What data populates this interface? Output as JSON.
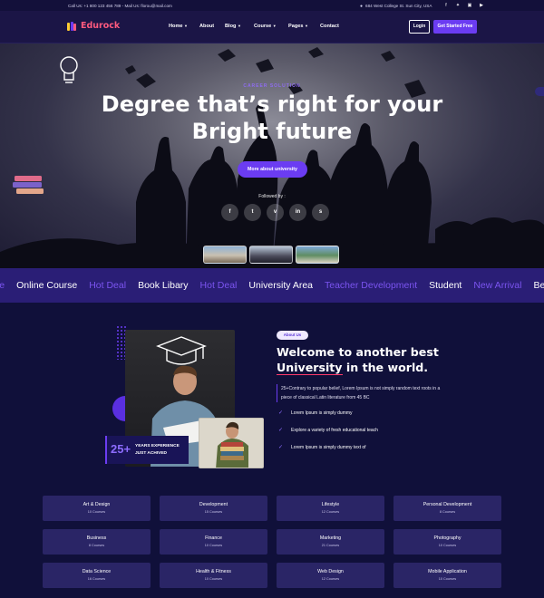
{
  "topbar": {
    "contact": "Call Us: +1 800 123 456 789 - Mail Us: florou@mail.com",
    "address": "684 West College St. Sun City, USA",
    "social_icons": [
      "facebook-icon",
      "twitter-icon",
      "instagram-icon",
      "youtube-icon"
    ]
  },
  "nav": {
    "logo": "Edurock",
    "items": [
      {
        "label": "Home",
        "dropdown": true
      },
      {
        "label": "About",
        "dropdown": false
      },
      {
        "label": "Blog",
        "dropdown": true
      },
      {
        "label": "Course",
        "dropdown": true
      },
      {
        "label": "Pages",
        "dropdown": true
      },
      {
        "label": "Contact",
        "dropdown": false
      }
    ],
    "login": "Login",
    "get_started": "Get Started Free"
  },
  "hero": {
    "subtitle": "CAREER SOLUTION",
    "title_line1": "Degree that’s right for your",
    "title_line2": "Bright future",
    "cta": "More about university",
    "followed_by": "Followed by :",
    "social_letters": [
      "f",
      "t",
      "v",
      "in",
      "s"
    ]
  },
  "ticker": [
    {
      "text": "se",
      "style": "b"
    },
    {
      "text": "Online Course",
      "style": "a"
    },
    {
      "text": "Hot Deal",
      "style": "b"
    },
    {
      "text": "Book Libary",
      "style": "a"
    },
    {
      "text": "Hot Deal",
      "style": "b"
    },
    {
      "text": "University Area",
      "style": "a"
    },
    {
      "text": "Teacher Development",
      "style": "b"
    },
    {
      "text": "Student",
      "style": "a"
    },
    {
      "text": "New Arrival",
      "style": "b"
    },
    {
      "text": "Best Colle",
      "style": "a"
    }
  ],
  "about": {
    "tag": "About Us",
    "heading_part1": "Welcome to another best",
    "heading_highlight": "University",
    "heading_part2": " in the world.",
    "description": "25+Contrary to popular belief, Lorem Ipsum is not simply random text roots in a piece of classical Latin literature from 45 BC",
    "checklist": [
      "Lorem Ipsum is simply dummy",
      "Explore a variety of fresh educational teach",
      "Lorem Ipsum is simply dummy text of"
    ],
    "experience_number": "25+",
    "experience_label_1": "YEARS EXPERIENCE",
    "experience_label_2": "JUST ACHIVED"
  },
  "categories": [
    {
      "name": "Art & Design",
      "count": "10 Courses"
    },
    {
      "name": "Development",
      "count": "15 Courses"
    },
    {
      "name": "Lifestyle",
      "count": "12 Courses"
    },
    {
      "name": "Personal Development",
      "count": "8 Courses"
    },
    {
      "name": "Business",
      "count": "8 Courses"
    },
    {
      "name": "Finance",
      "count": "10 Courses"
    },
    {
      "name": "Marketing",
      "count": "21 Courses"
    },
    {
      "name": "Photography",
      "count": "10 Courses"
    },
    {
      "name": "Data Science",
      "count": "16 Courses"
    },
    {
      "name": "Health & Fitness",
      "count": "10 Courses"
    },
    {
      "name": "Web Design",
      "count": "12 Courses"
    },
    {
      "name": "Mobile Application",
      "count": "10 Courses"
    }
  ],
  "colors": {
    "accent": "#6b3cf2",
    "highlight": "#ff3b6b",
    "background": "#10103a"
  }
}
